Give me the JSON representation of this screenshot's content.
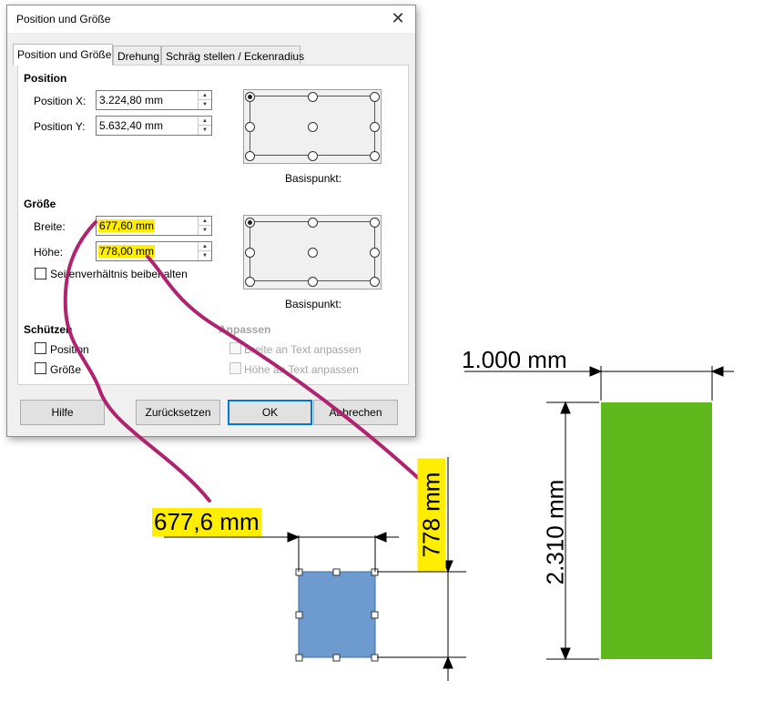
{
  "dialog": {
    "title": "Position und Größe",
    "close_glyph": "✕",
    "tabs": [
      {
        "label": "Position und Größe"
      },
      {
        "label": "Drehung"
      },
      {
        "label": "Schräg stellen / Eckenradius"
      }
    ],
    "position": {
      "heading": "Position",
      "x_label": "Position X:",
      "x_value": "3.224,80 mm",
      "y_label": "Position Y:",
      "y_value": "5.632,40 mm",
      "basis_label": "Basispunkt:"
    },
    "size": {
      "heading": "Größe",
      "width_label": "Breite:",
      "width_value": "677,60 mm",
      "height_label": "Höhe:",
      "height_value": "778,00 mm",
      "keep_ratio_label": "Seitenverhältnis beibehalten",
      "basis_label": "Basispunkt:"
    },
    "protect": {
      "heading": "Schützen",
      "position_label": "Position",
      "size_label": "Größe"
    },
    "adapt": {
      "heading": "Anpassen",
      "fit_width_label": "Breite an Text anpassen",
      "fit_height_label": "Höhe an Text anpassen"
    },
    "buttons": {
      "help": "Hilfe",
      "reset": "Zurücksetzen",
      "ok": "OK",
      "cancel": "Abbrechen"
    }
  },
  "drawing": {
    "blue_width_label": "677,6 mm",
    "blue_height_label": "778 mm",
    "green_width_label": "1.000 mm",
    "green_height_label": "2.310 mm",
    "colors": {
      "blue_rect": "#6e9bcf",
      "green_rect": "#5eb81c",
      "highlight": "#ffee00",
      "annotation": "#b0236e"
    }
  }
}
